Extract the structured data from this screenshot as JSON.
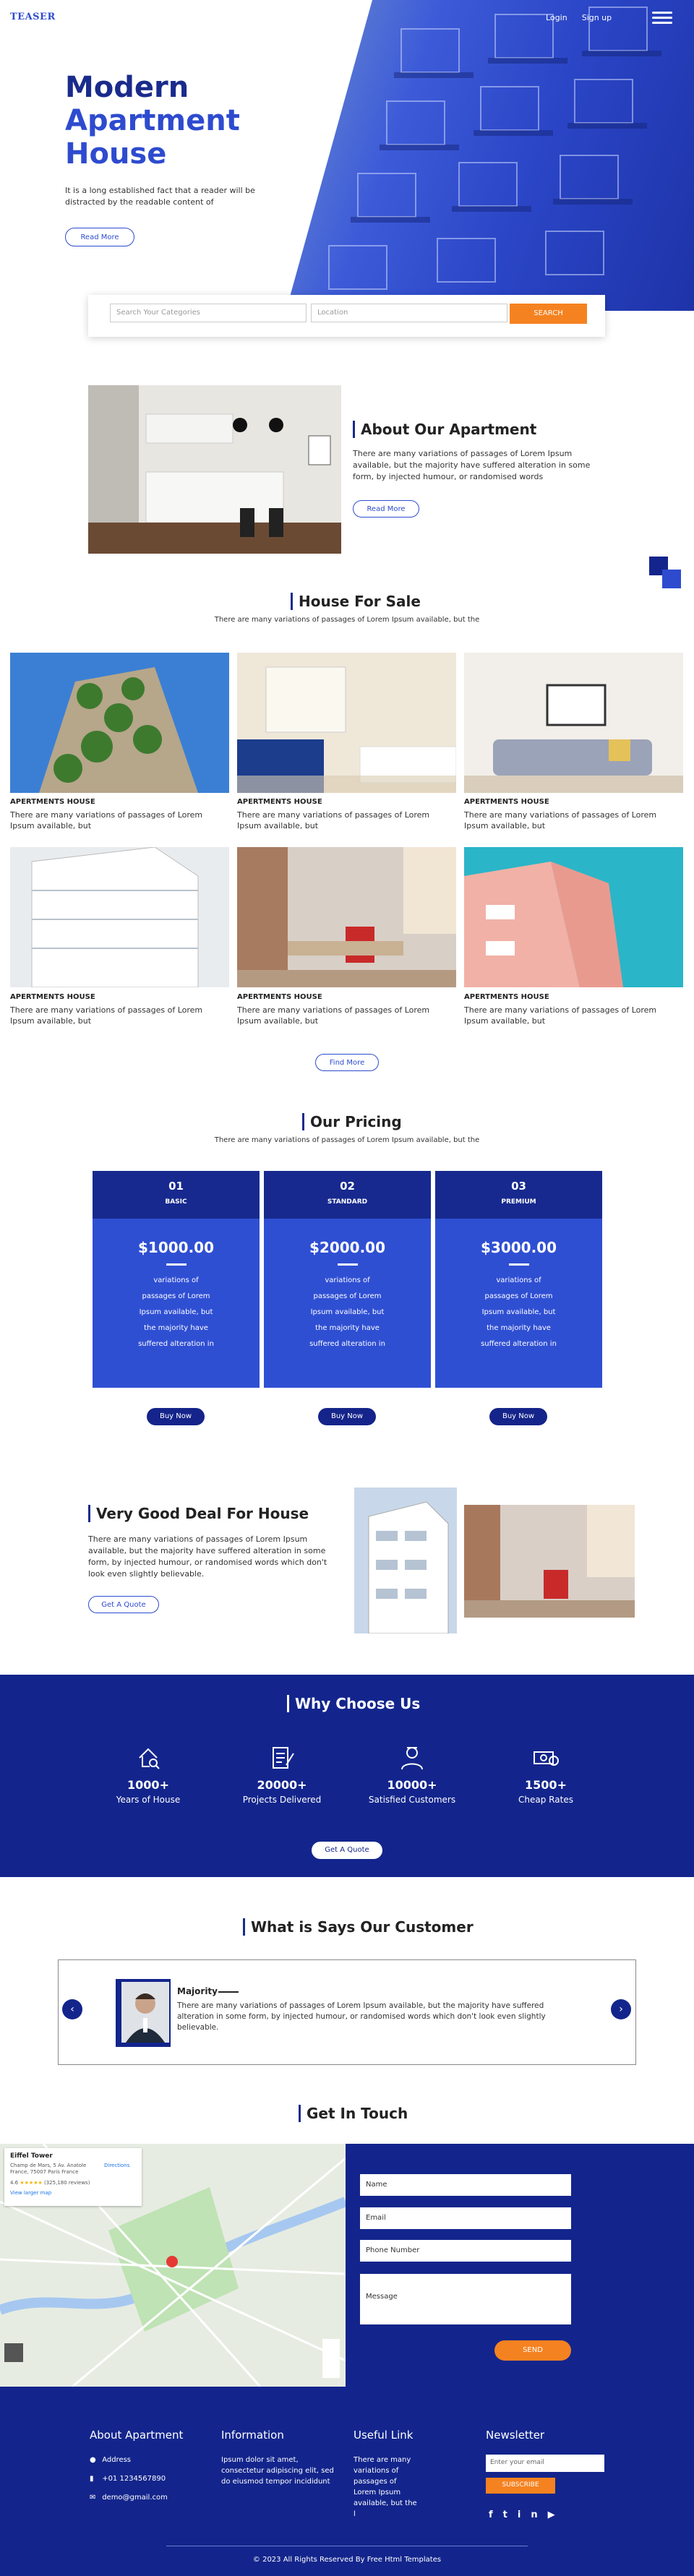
{
  "header": {
    "logo": "TEASER",
    "nav": [
      "Login",
      "Sign up"
    ]
  },
  "hero": {
    "title_1": "Modern",
    "title_2": "Apartment",
    "title_3": "House",
    "subtitle": "It is a long established fact that a reader will be distracted by the readable content of",
    "button": "Read More"
  },
  "search": {
    "category_placeholder": "Search Your Categories",
    "location_placeholder": "Location",
    "button": "SEARCH"
  },
  "about": {
    "title": "About Our Apartment",
    "text": "There are many variations of passages of Lorem Ipsum available, but the majority have suffered alteration in some form, by injected humour, or randomised words",
    "button": "Read More"
  },
  "sale": {
    "title": "House For Sale",
    "subtitle": "There are many variations of passages of Lorem Ipsum available, but the",
    "cards": [
      {
        "title": "APERTMENTS HOUSE",
        "text": "There are many variations of passages of Lorem Ipsum available, but"
      },
      {
        "title": "APERTMENTS HOUSE",
        "text": "There are many variations of passages of Lorem Ipsum available, but"
      },
      {
        "title": "APERTMENTS HOUSE",
        "text": "There are many variations of passages of Lorem Ipsum available, but"
      },
      {
        "title": "APERTMENTS HOUSE",
        "text": "There are many variations of passages of Lorem Ipsum available, but"
      },
      {
        "title": "APERTMENTS HOUSE",
        "text": "There are many variations of passages of Lorem Ipsum available, but"
      },
      {
        "title": "APERTMENTS HOUSE",
        "text": "There are many variations of passages of Lorem Ipsum available, but"
      }
    ],
    "button": "Find More"
  },
  "pricing": {
    "title": "Our Pricing",
    "subtitle": "There are many variations of passages of Lorem Ipsum available, but the",
    "plans": [
      {
        "num": "01",
        "name": "BASIC",
        "price": "$1000.00",
        "desc": "variations of passages of Lorem Ipsum available, but the majority have suffered alteration in",
        "button": "Buy Now"
      },
      {
        "num": "02",
        "name": "STANDARD",
        "price": "$2000.00",
        "desc": "variations of passages of Lorem Ipsum available, but the majority have suffered alteration in",
        "button": "Buy Now"
      },
      {
        "num": "03",
        "name": "PREMIUM",
        "price": "$3000.00",
        "desc": "variations of passages of Lorem Ipsum available, but the majority have suffered alteration in",
        "button": "Buy Now"
      }
    ]
  },
  "deal": {
    "title": "Very Good Deal For House",
    "text": "There are many variations of passages of Lorem Ipsum available, but the majority have suffered alteration in some form, by injected humour, or randomised words which don't look even slightly believable.",
    "button": "Get A Quote"
  },
  "why": {
    "title": "Why Choose Us",
    "stats": [
      {
        "num": "1000+",
        "label": "Years of House"
      },
      {
        "num": "20000+",
        "label": "Projects Delivered"
      },
      {
        "num": "10000+",
        "label": "Satisfied Customers"
      },
      {
        "num": "1500+",
        "label": "Cheap Rates"
      }
    ],
    "button": "Get A Quote"
  },
  "testimonial": {
    "title": "What is Says Our Customer",
    "name": "Majority",
    "text": "There are many variations of passages of Lorem Ipsum available, but the majority have suffered alteration in some form, by injected humour, or randomised words which don't look even slightly believable."
  },
  "contact": {
    "title": "Get In Touch",
    "map_place": "Eiffel Tower",
    "map_addr": "Champ de Mars, 5 Av. Anatole France, 75007 Paris France",
    "map_rating": "4.6",
    "map_reviews": "(325,180 reviews)",
    "map_link": "View larger map",
    "map_dir": "Directions",
    "fields": [
      "Name",
      "Email",
      "Phone Number",
      "Message"
    ],
    "button": "SEND"
  },
  "footer": {
    "about_title": "About Apartment",
    "address": "Address",
    "phone": "+01 1234567890",
    "email": "demo@gmail.com",
    "info_title": "Information",
    "info_text": "Ipsum dolor sit amet, consectetur adipiscing elit, sed do eiusmod tempor incididunt",
    "links_title": "Useful Link",
    "links_text": "There are many variations of passages of Lorem Ipsum available, but the l",
    "news_title": "Newsletter",
    "news_placeholder": "Enter your email",
    "news_button": "SUBSCRIBE",
    "copyright": "© 2023 All Rights Reserved By Free Html Templates"
  }
}
